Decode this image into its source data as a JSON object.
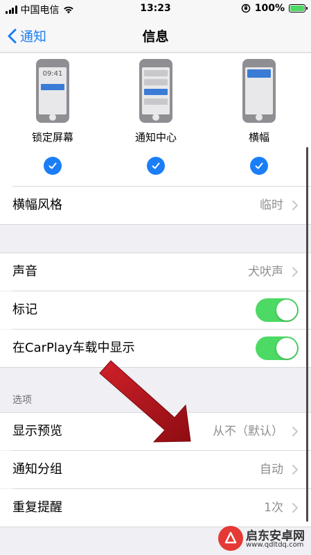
{
  "status": {
    "carrier": "中国电信",
    "time": "13:23",
    "battery": "100%",
    "battery_level": 1.0
  },
  "nav": {
    "back_label": "通知",
    "title": "信息"
  },
  "alert_styles": [
    {
      "label": "锁定屏幕",
      "clock": "09:41",
      "checked": true
    },
    {
      "label": "通知中心",
      "checked": true
    },
    {
      "label": "横幅",
      "checked": true
    }
  ],
  "banner_style": {
    "label": "横幅风格",
    "value": "临时"
  },
  "sound": {
    "label": "声音",
    "value": "犬吠声"
  },
  "badges": {
    "label": "标记",
    "on": true
  },
  "carplay": {
    "label": "在CarPlay车载中显示",
    "on": true
  },
  "options_header": "选项",
  "show_previews": {
    "label": "显示预览",
    "value": "从不（默认）"
  },
  "grouping": {
    "label": "通知分组",
    "value": "自动"
  },
  "repeat": {
    "label": "重复提醒",
    "value": "1次"
  },
  "watermark": {
    "title": "启东安卓网",
    "url": "www.qdltdq.com"
  },
  "colors": {
    "accent": "#1b7ef6",
    "toggle_on": "#4cd964",
    "arrow": "#b3141a"
  }
}
